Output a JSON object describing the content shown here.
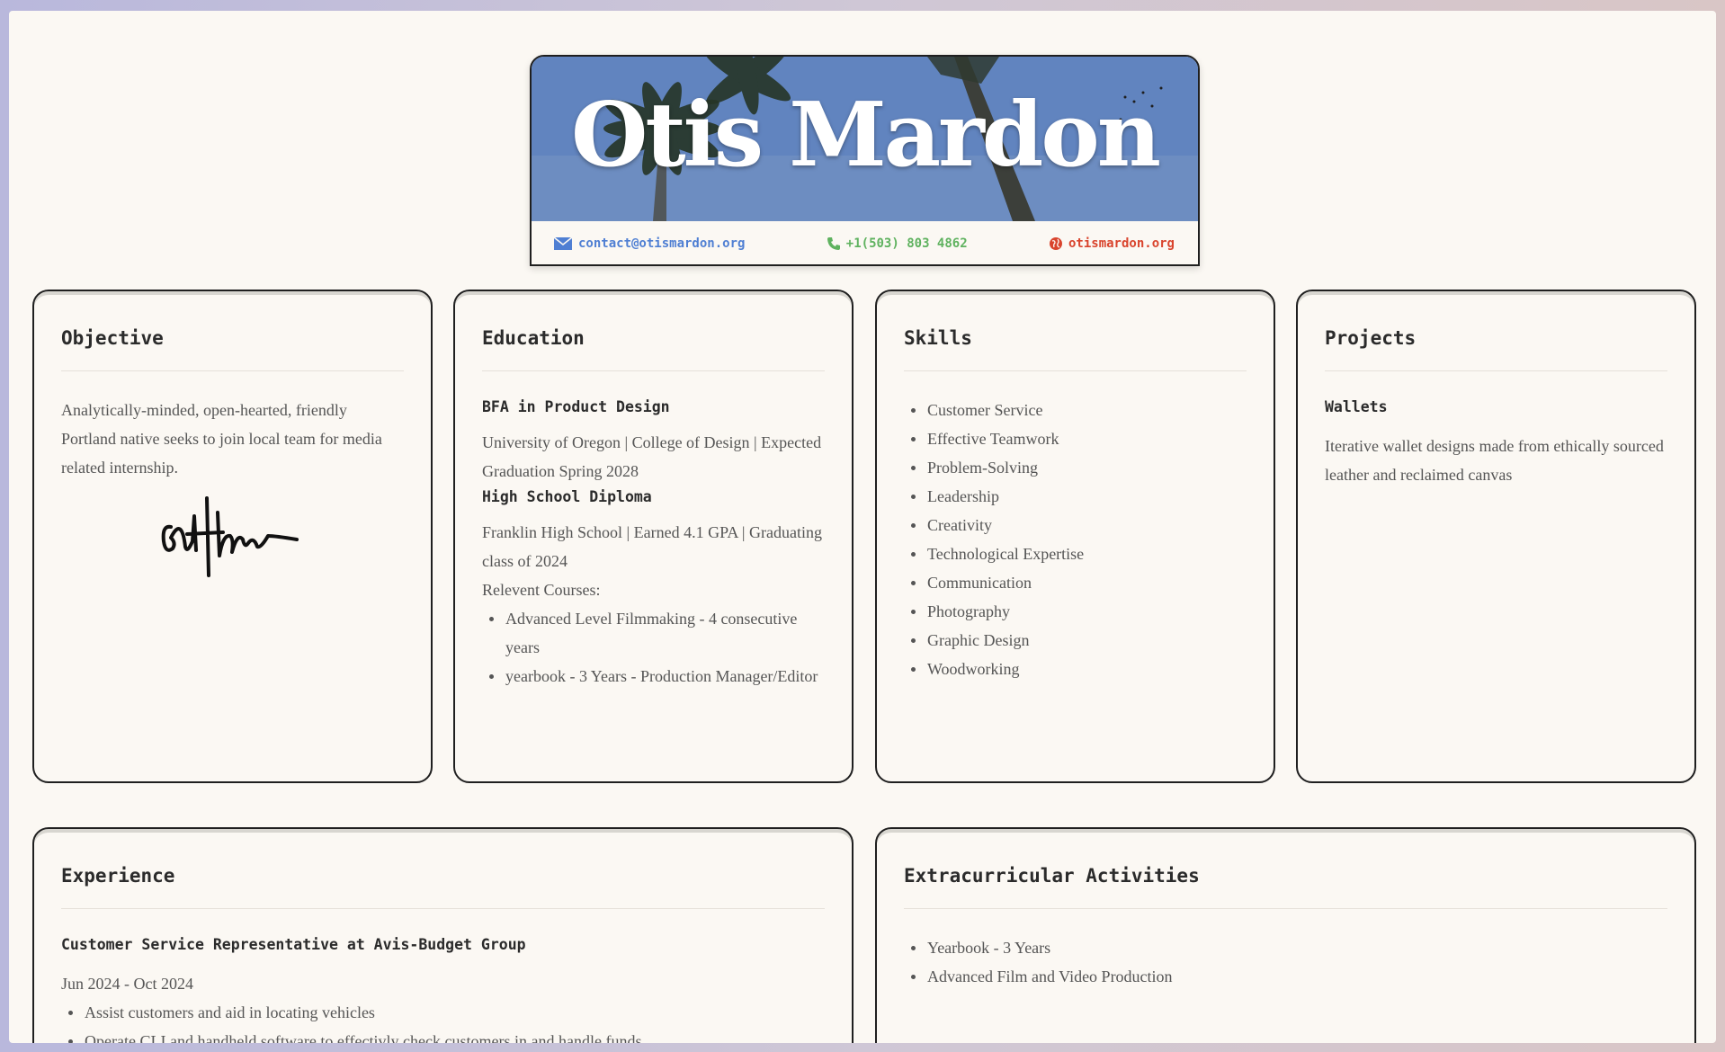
{
  "header": {
    "name": "Otis Mardon",
    "email": "contact@otismardon.org",
    "phone": "+1(503) 803 4862",
    "website": "otismardon.org",
    "icons": {
      "email": "envelope-icon",
      "phone": "phone-icon",
      "website": "globe-icon"
    }
  },
  "colors": {
    "email": "#4f7fd3",
    "phone": "#5fb25f",
    "website": "#d9442d",
    "banner": "#5f82bd"
  },
  "objective": {
    "title": "Objective",
    "text": "Analytically-minded, open-hearted, friendly Portland native seeks to join local team for media related internship."
  },
  "education": {
    "title": "Education",
    "degree1": "BFA in Product Design",
    "degree1_detail": "University of Oregon | College of Design | Expected Graduation Spring 2028",
    "degree2": "High School Diploma",
    "degree2_detail": "Franklin High School | Earned 4.1 GPA | Graduating class of 2024",
    "courses_label": "Relevent Courses:",
    "courses": [
      "Advanced Level Filmmaking - 4 consecutive years",
      "yearbook - 3 Years - Production Manager/Editor"
    ]
  },
  "skills": {
    "title": "Skills",
    "items": [
      "Customer Service",
      "Effective Teamwork",
      "Problem-Solving",
      "Leadership",
      "Creativity",
      "Technological Expertise",
      "Communication",
      "Photography",
      "Graphic Design",
      "Woodworking"
    ]
  },
  "projects": {
    "title": "Projects",
    "project1_name": "Wallets",
    "project1_desc": "Iterative wallet designs made from ethically sourced leather and reclaimed canvas"
  },
  "experience": {
    "title": "Experience",
    "job1_title": "Customer Service Representative at Avis-Budget Group",
    "job1_dates": "Jun 2024 - Oct 2024",
    "job1_bullets": [
      "Assist customers and aid in locating vehicles",
      "Operate CLI and handheld software to effectivly check customers in and handle funds"
    ]
  },
  "extracurricular": {
    "title": "Extracurricular Activities",
    "items": [
      "Yearbook - 3 Years",
      "Advanced Film and Video Production"
    ]
  }
}
